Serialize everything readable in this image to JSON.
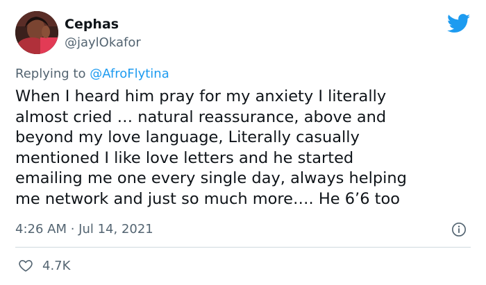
{
  "user": {
    "display_name": "Cephas",
    "handle": "@jaylOkafor",
    "avatar_icon": "profile-photo"
  },
  "reply": {
    "prefix": "Replying to ",
    "mention": "@AfroFlytina"
  },
  "tweet": {
    "lines": [
      "When I heard him pray for my anxiety I literally",
      "almost cried … natural reassurance, above and",
      "beyond my love language, Literally casually",
      "mentioned I like love letters and he started",
      "emailing me one every single day, always helping",
      "me network and just so much more…. He 6’6 too"
    ],
    "timestamp": "4:26 AM · Jul 14, 2021"
  },
  "stats": {
    "likes": "4.7K"
  },
  "icons": {
    "brand": "twitter-bird-icon",
    "info": "info-icon",
    "like": "heart-icon"
  },
  "colors": {
    "brand_blue": "#1d9bf0",
    "secondary_text": "#536471",
    "primary_text": "#0f1419",
    "divider": "#cfd9de"
  }
}
